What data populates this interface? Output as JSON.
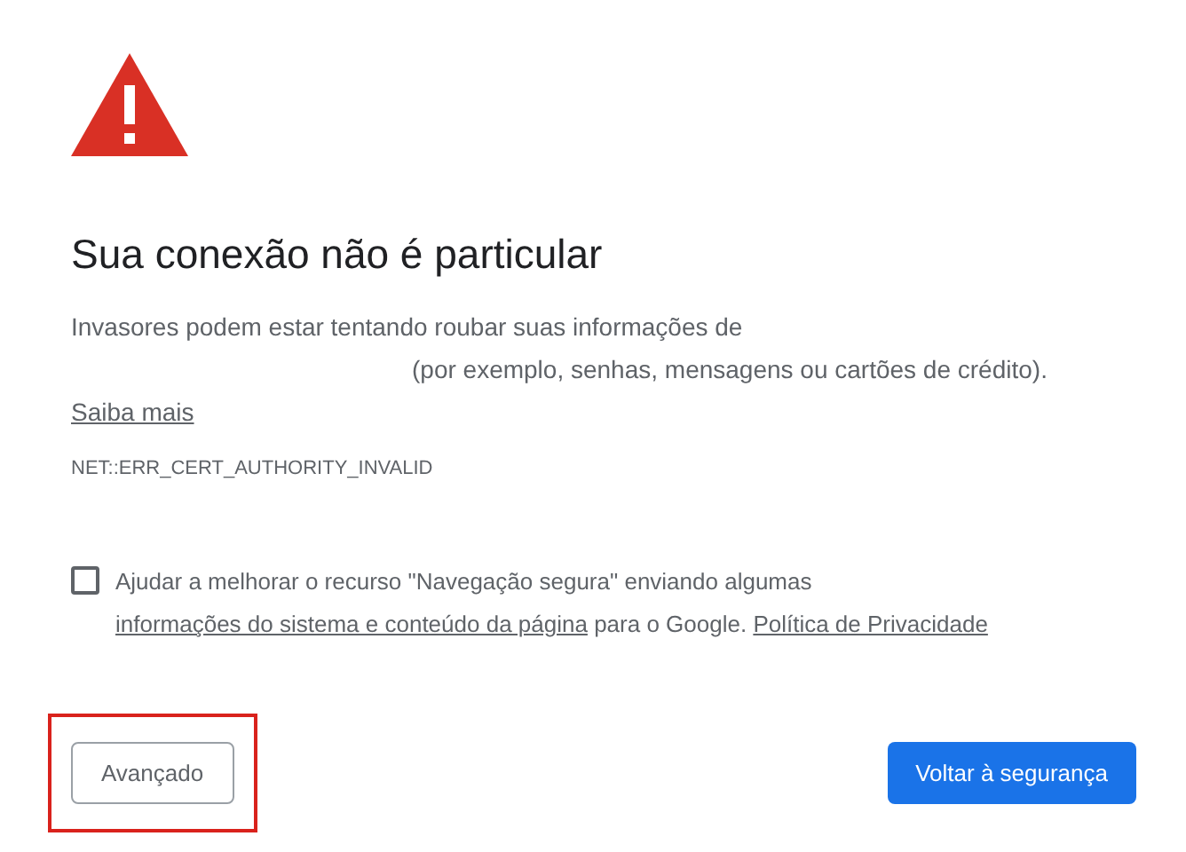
{
  "title": "Sua conexão não é particular",
  "message": {
    "line_1": "Invasores podem estar tentando roubar suas informações de",
    "line_2": "(por exemplo, senhas, mensagens ou cartões de crédito)."
  },
  "learn_more": "Saiba mais",
  "error_code": "NET::ERR_CERT_AUTHORITY_INVALID",
  "opt_in": {
    "checked": false,
    "parts": [
      {
        "kind": "text",
        "text": "Ajudar a melhorar o recurso \"Navegação segura\" enviando algumas "
      },
      {
        "kind": "link",
        "text": "informações do sistema e conteúdo da página"
      },
      {
        "kind": "text",
        "text": " para o Google. "
      },
      {
        "kind": "link",
        "text": "Política de Privacidade"
      }
    ]
  },
  "buttons": {
    "advanced": "Avançado",
    "back": "Voltar à segurança"
  }
}
